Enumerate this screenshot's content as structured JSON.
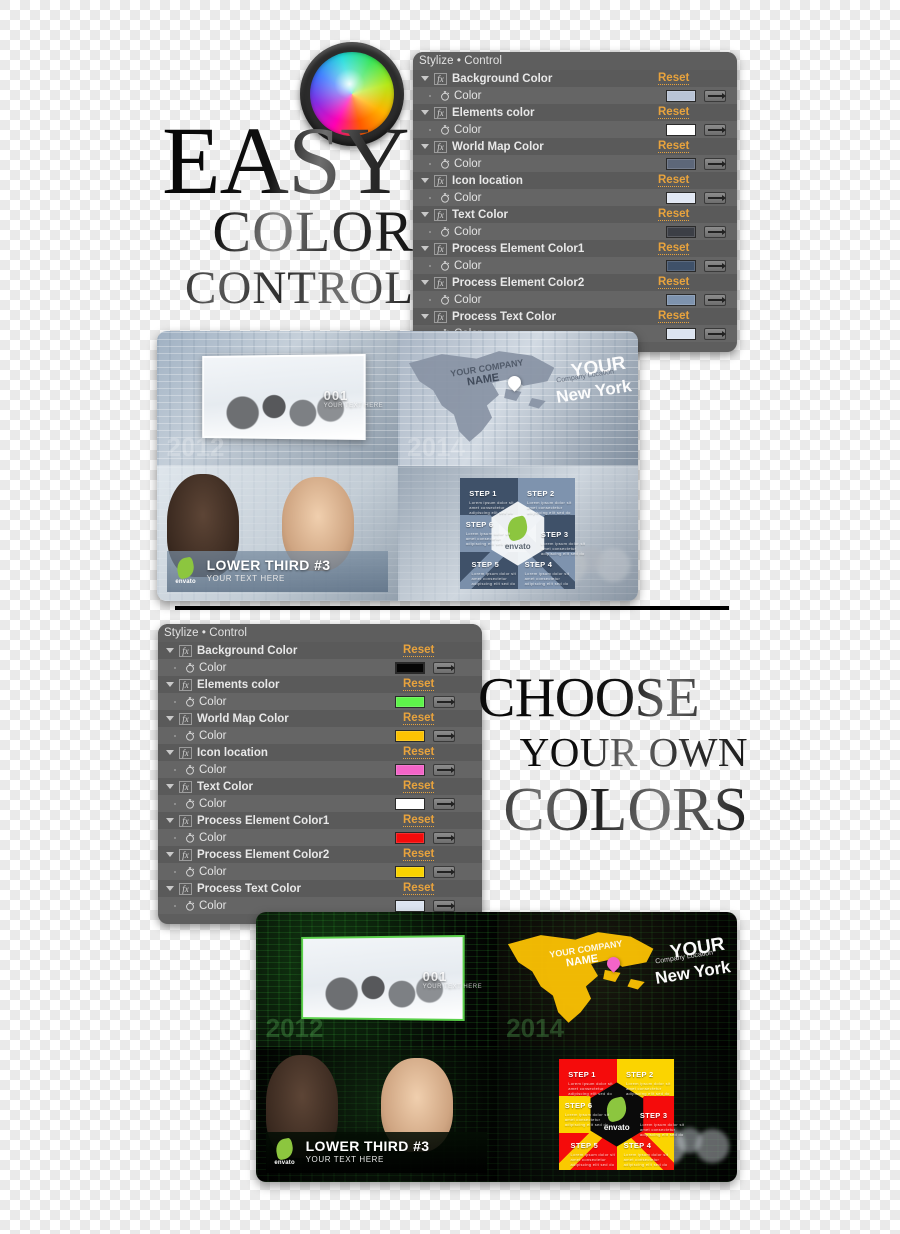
{
  "hero": {
    "line1": "EASY",
    "line2": "COLOR",
    "line3": "CONTROL",
    "wheel_icon": "color-wheel-icon"
  },
  "hero2": {
    "line1": "CHOOSE",
    "line2": "YOUR OWN",
    "line3": "COLORS"
  },
  "panel_top": {
    "header": "Stylize • Control",
    "reset_label": "Reset",
    "property_label": "Color",
    "fx_label": "fx",
    "effects": [
      {
        "name": "Background Color",
        "swatch": "#b9c4d6"
      },
      {
        "name": "Elements color",
        "swatch": "#ffffff"
      },
      {
        "name": "World Map Color",
        "swatch": "#5d6779"
      },
      {
        "name": "Icon location",
        "swatch": "#e1e7f3"
      },
      {
        "name": "Text Color",
        "swatch": "#3c3f46"
      },
      {
        "name": "Process Element Color1",
        "swatch": "#3f5169"
      },
      {
        "name": "Process Element Color2",
        "swatch": "#7e93ae"
      },
      {
        "name": "Process Text Color",
        "swatch": "#dce4f0"
      }
    ]
  },
  "panel_bottom": {
    "header": "Stylize • Control",
    "reset_label": "Reset",
    "property_label": "Color",
    "fx_label": "fx",
    "effects": [
      {
        "name": "Background Color",
        "swatch": "#050505"
      },
      {
        "name": "Elements color",
        "swatch": "#5ef54a"
      },
      {
        "name": "World Map Color",
        "swatch": "#fcc203"
      },
      {
        "name": "Icon location",
        "swatch": "#f364c8"
      },
      {
        "name": "Text Color",
        "swatch": "#ffffff"
      },
      {
        "name": "Process Element Color1",
        "swatch": "#f50b0b"
      },
      {
        "name": "Process Element Color2",
        "swatch": "#fbd400"
      },
      {
        "name": "Process Text Color",
        "swatch": "#dce4f0"
      }
    ]
  },
  "preview_light": {
    "cell_meeting": {
      "number": "001",
      "number_sub": "YOUR TEXT HERE",
      "year": "2012"
    },
    "cell_map": {
      "left_line1": "YOUR COMPANY",
      "left_line2": "NAME",
      "right_line1": "YOUR",
      "right_line2": "Company Location",
      "right_line3": "New York",
      "year": "2014",
      "map_color": "#8893a4",
      "pin_color": "#ffffff"
    },
    "cell_lower_third": {
      "title": "LOWER THIRD #3",
      "subtitle": "YOUR TEXT HERE",
      "logo": "envato"
    },
    "cell_process": {
      "steps": [
        "STEP 1",
        "STEP 2",
        "STEP 3",
        "STEP 4",
        "STEP 5",
        "STEP 6"
      ],
      "step_body": "Lorem ipsum dolor sit amet consectetur adipiscing elit sed do",
      "logo": "envato",
      "color1": "#3f5169",
      "color2": "#7e93ae"
    }
  },
  "preview_dark": {
    "cell_meeting": {
      "number": "001",
      "number_sub": "YOUR TEXT HERE",
      "year": "2012"
    },
    "cell_map": {
      "left_line1": "YOUR COMPANY",
      "left_line2": "NAME",
      "right_line1": "YOUR",
      "right_line2": "Company Location",
      "right_line3": "New York",
      "year": "2014",
      "map_color": "#fcc203",
      "pin_color": "#f364c8"
    },
    "cell_lower_third": {
      "title": "LOWER THIRD #3",
      "subtitle": "YOUR TEXT HERE",
      "logo": "envato"
    },
    "cell_process": {
      "steps": [
        "STEP 1",
        "STEP 2",
        "STEP 3",
        "STEP 4",
        "STEP 5",
        "STEP 6"
      ],
      "step_body": "Lorem ipsum dolor sit amet consectetur adipiscing elit sed do",
      "logo": "envato",
      "color1": "#f50b0b",
      "color2": "#fbd400"
    }
  }
}
